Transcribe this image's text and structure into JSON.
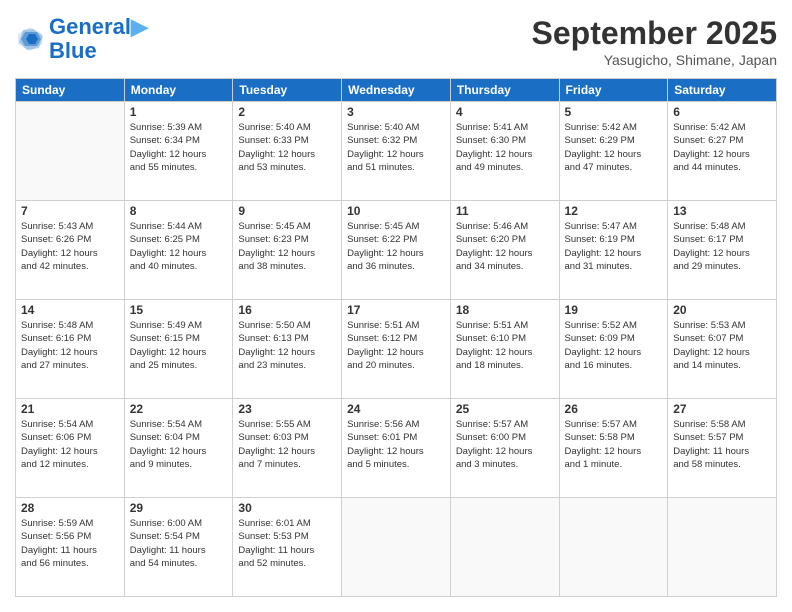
{
  "header": {
    "logo_line1": "General",
    "logo_line2": "Blue",
    "month_year": "September 2025",
    "location": "Yasugicho, Shimane, Japan"
  },
  "weekdays": [
    "Sunday",
    "Monday",
    "Tuesday",
    "Wednesday",
    "Thursday",
    "Friday",
    "Saturday"
  ],
  "weeks": [
    [
      {
        "day": "",
        "info": ""
      },
      {
        "day": "1",
        "info": "Sunrise: 5:39 AM\nSunset: 6:34 PM\nDaylight: 12 hours\nand 55 minutes."
      },
      {
        "day": "2",
        "info": "Sunrise: 5:40 AM\nSunset: 6:33 PM\nDaylight: 12 hours\nand 53 minutes."
      },
      {
        "day": "3",
        "info": "Sunrise: 5:40 AM\nSunset: 6:32 PM\nDaylight: 12 hours\nand 51 minutes."
      },
      {
        "day": "4",
        "info": "Sunrise: 5:41 AM\nSunset: 6:30 PM\nDaylight: 12 hours\nand 49 minutes."
      },
      {
        "day": "5",
        "info": "Sunrise: 5:42 AM\nSunset: 6:29 PM\nDaylight: 12 hours\nand 47 minutes."
      },
      {
        "day": "6",
        "info": "Sunrise: 5:42 AM\nSunset: 6:27 PM\nDaylight: 12 hours\nand 44 minutes."
      }
    ],
    [
      {
        "day": "7",
        "info": "Sunrise: 5:43 AM\nSunset: 6:26 PM\nDaylight: 12 hours\nand 42 minutes."
      },
      {
        "day": "8",
        "info": "Sunrise: 5:44 AM\nSunset: 6:25 PM\nDaylight: 12 hours\nand 40 minutes."
      },
      {
        "day": "9",
        "info": "Sunrise: 5:45 AM\nSunset: 6:23 PM\nDaylight: 12 hours\nand 38 minutes."
      },
      {
        "day": "10",
        "info": "Sunrise: 5:45 AM\nSunset: 6:22 PM\nDaylight: 12 hours\nand 36 minutes."
      },
      {
        "day": "11",
        "info": "Sunrise: 5:46 AM\nSunset: 6:20 PM\nDaylight: 12 hours\nand 34 minutes."
      },
      {
        "day": "12",
        "info": "Sunrise: 5:47 AM\nSunset: 6:19 PM\nDaylight: 12 hours\nand 31 minutes."
      },
      {
        "day": "13",
        "info": "Sunrise: 5:48 AM\nSunset: 6:17 PM\nDaylight: 12 hours\nand 29 minutes."
      }
    ],
    [
      {
        "day": "14",
        "info": "Sunrise: 5:48 AM\nSunset: 6:16 PM\nDaylight: 12 hours\nand 27 minutes."
      },
      {
        "day": "15",
        "info": "Sunrise: 5:49 AM\nSunset: 6:15 PM\nDaylight: 12 hours\nand 25 minutes."
      },
      {
        "day": "16",
        "info": "Sunrise: 5:50 AM\nSunset: 6:13 PM\nDaylight: 12 hours\nand 23 minutes."
      },
      {
        "day": "17",
        "info": "Sunrise: 5:51 AM\nSunset: 6:12 PM\nDaylight: 12 hours\nand 20 minutes."
      },
      {
        "day": "18",
        "info": "Sunrise: 5:51 AM\nSunset: 6:10 PM\nDaylight: 12 hours\nand 18 minutes."
      },
      {
        "day": "19",
        "info": "Sunrise: 5:52 AM\nSunset: 6:09 PM\nDaylight: 12 hours\nand 16 minutes."
      },
      {
        "day": "20",
        "info": "Sunrise: 5:53 AM\nSunset: 6:07 PM\nDaylight: 12 hours\nand 14 minutes."
      }
    ],
    [
      {
        "day": "21",
        "info": "Sunrise: 5:54 AM\nSunset: 6:06 PM\nDaylight: 12 hours\nand 12 minutes."
      },
      {
        "day": "22",
        "info": "Sunrise: 5:54 AM\nSunset: 6:04 PM\nDaylight: 12 hours\nand 9 minutes."
      },
      {
        "day": "23",
        "info": "Sunrise: 5:55 AM\nSunset: 6:03 PM\nDaylight: 12 hours\nand 7 minutes."
      },
      {
        "day": "24",
        "info": "Sunrise: 5:56 AM\nSunset: 6:01 PM\nDaylight: 12 hours\nand 5 minutes."
      },
      {
        "day": "25",
        "info": "Sunrise: 5:57 AM\nSunset: 6:00 PM\nDaylight: 12 hours\nand 3 minutes."
      },
      {
        "day": "26",
        "info": "Sunrise: 5:57 AM\nSunset: 5:58 PM\nDaylight: 12 hours\nand 1 minute."
      },
      {
        "day": "27",
        "info": "Sunrise: 5:58 AM\nSunset: 5:57 PM\nDaylight: 11 hours\nand 58 minutes."
      }
    ],
    [
      {
        "day": "28",
        "info": "Sunrise: 5:59 AM\nSunset: 5:56 PM\nDaylight: 11 hours\nand 56 minutes."
      },
      {
        "day": "29",
        "info": "Sunrise: 6:00 AM\nSunset: 5:54 PM\nDaylight: 11 hours\nand 54 minutes."
      },
      {
        "day": "30",
        "info": "Sunrise: 6:01 AM\nSunset: 5:53 PM\nDaylight: 11 hours\nand 52 minutes."
      },
      {
        "day": "",
        "info": ""
      },
      {
        "day": "",
        "info": ""
      },
      {
        "day": "",
        "info": ""
      },
      {
        "day": "",
        "info": ""
      }
    ]
  ]
}
